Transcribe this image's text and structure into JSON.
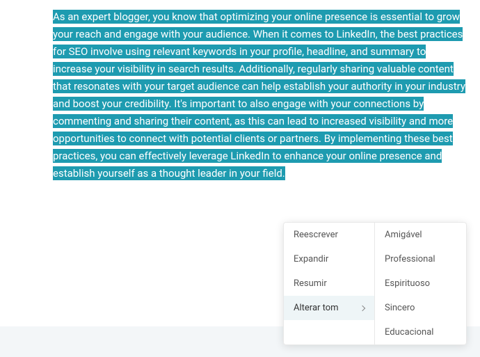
{
  "content": {
    "highlighted_text": "As an expert blogger, you know that optimizing your online presence is essential to grow your reach and engage with your audience. When it comes to LinkedIn, the best practices for SEO involve using relevant keywords in your profile, headline, and summary to increase your visibility in search results. Additionally, regularly sharing valuable content that resonates with your target audience can help establish your authority in your industry and boost your credibility. It's important to also engage with your connections by commenting and sharing their content, as this can lead to increased visibility and more opportunities to connect with potential clients or partners. By implementing these best practices, you can effectively leverage LinkedIn to enhance your online presence and establish yourself as a thought leader in your field."
  },
  "menu": {
    "primary": {
      "items": [
        {
          "label": "Reescrever"
        },
        {
          "label": "Expandir"
        },
        {
          "label": "Resumir"
        },
        {
          "label": "Alterar tom"
        }
      ]
    },
    "secondary": {
      "items": [
        {
          "label": "Amigável"
        },
        {
          "label": "Professional"
        },
        {
          "label": "Espirituoso"
        },
        {
          "label": "Sincero"
        },
        {
          "label": "Educacional"
        }
      ]
    }
  }
}
